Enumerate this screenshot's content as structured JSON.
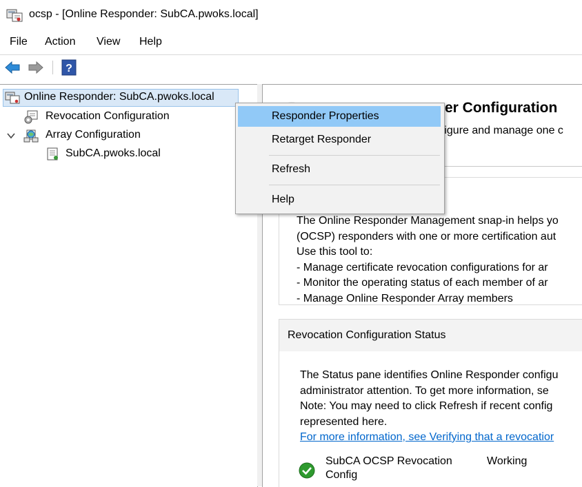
{
  "window": {
    "title": "ocsp - [Online Responder: SubCA.pwoks.local]"
  },
  "menu": {
    "file": "File",
    "action": "Action",
    "view": "View",
    "help": "Help"
  },
  "tree": {
    "root": "Online Responder: SubCA.pwoks.local",
    "revocation": "Revocation Configuration",
    "array": "Array Configuration",
    "array_member": "SubCA.pwoks.local"
  },
  "context_menu": {
    "properties": "Responder Properties",
    "retarget": "Retarget Responder",
    "refresh": "Refresh",
    "help": "Help"
  },
  "content": {
    "title_partial": "er Configuration",
    "subtitle_partial": "nfigure and manage one c",
    "overview": {
      "lines": [
        "The Online Responder Management snap-in helps yo",
        "(OCSP) responders with one or more certification aut",
        "Use this tool to:",
        "-  Manage certificate revocation configurations for ar",
        "-  Monitor the operating status of each member of ar",
        "-  Manage Online Responder Array members"
      ]
    },
    "status_panel": {
      "header": "Revocation Configuration Status",
      "lines": [
        "The Status pane identifies Online Responder configu",
        "administrator attention. To get more information, se",
        "Note: You may need to click Refresh if recent config",
        "represented here."
      ],
      "link": "For more information, see Verifying that a revocatior",
      "row": {
        "name_line1": "SubCA OCSP Revocation",
        "name_line2": "Config",
        "status": "Working"
      }
    }
  }
}
